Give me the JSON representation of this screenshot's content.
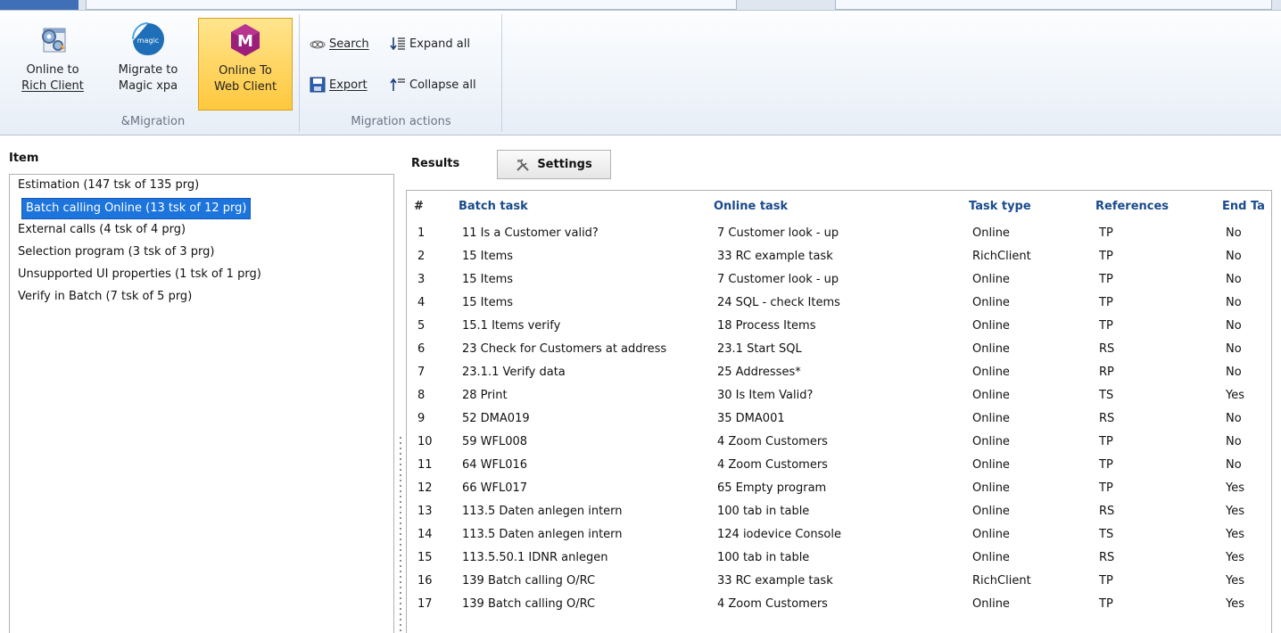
{
  "ribbon": {
    "groups": [
      {
        "label": "&Migration",
        "buttons": [
          {
            "label_line1": "Online to",
            "label_line2": "Rich Client",
            "icon": "gear-window-icon"
          },
          {
            "label_line1": "Migrate to",
            "label_line2": "Magic xpa",
            "icon": "magic-logo-icon",
            "icon_text": "magic"
          },
          {
            "label_line1": "Online To",
            "label_line2": "Web Client",
            "icon": "magic-m-icon",
            "icon_text": "M",
            "active": true
          }
        ]
      },
      {
        "label": "Migration actions",
        "buttons": [
          {
            "label": "Search",
            "icon": "search-glasses-icon"
          },
          {
            "label": "Export",
            "icon": "save-disk-icon"
          },
          {
            "label": "Expand all",
            "icon": "expand-all-icon"
          },
          {
            "label": "Collapse all",
            "icon": "collapse-all-icon"
          }
        ]
      }
    ]
  },
  "left_panel": {
    "title": "Item",
    "items": [
      {
        "label": "Estimation (147 tsk of 135 prg)"
      },
      {
        "label": "Batch calling Online (13 tsk of 12 prg)",
        "selected": true
      },
      {
        "label": "External calls (4 tsk of 4 prg)"
      },
      {
        "label": "Selection program (3 tsk of 3 prg)"
      },
      {
        "label": "Unsupported UI properties (1 tsk of 1 prg)"
      },
      {
        "label": "Verify in Batch (7 tsk of 5 prg)"
      }
    ]
  },
  "results": {
    "title": "Results",
    "settings_label": "Settings",
    "columns": [
      "#",
      "Batch task",
      "Online task",
      "Task type",
      "References",
      "End Ta"
    ],
    "rows": [
      [
        "1",
        "11 Is a Customer valid?",
        "7 Customer look - up",
        "Online",
        "TP",
        "No"
      ],
      [
        "2",
        "15 Items",
        "33 RC example task",
        "RichClient",
        "TP",
        "No"
      ],
      [
        "3",
        "15 Items",
        "7 Customer look - up",
        "Online",
        "TP",
        "No"
      ],
      [
        "4",
        "15 Items",
        "24 SQL - check Items",
        "Online",
        "TP",
        "No"
      ],
      [
        "5",
        "15.1 Items verify",
        "18 Process Items",
        "Online",
        "TP",
        "No"
      ],
      [
        "6",
        "23 Check for Customers at address",
        "23.1 Start SQL",
        "Online",
        "RS",
        "No"
      ],
      [
        "7",
        "23.1.1 Verify data",
        "25 Addresses*",
        "Online",
        "RP",
        "No"
      ],
      [
        "8",
        "28 Print",
        "30 Is Item Valid?",
        "Online",
        "TS",
        "Yes"
      ],
      [
        "9",
        "52 DMA019",
        "35 DMA001",
        "Online",
        "RS",
        "No"
      ],
      [
        "10",
        "59 WFL008",
        "4 Zoom Customers",
        "Online",
        "TP",
        "No"
      ],
      [
        "11",
        "64 WFL016",
        "4 Zoom Customers",
        "Online",
        "TP",
        "No"
      ],
      [
        "12",
        "66 WFL017",
        "65 Empty program",
        "Online",
        "TP",
        "Yes"
      ],
      [
        "13",
        "113.5 Daten anlegen intern",
        "100 tab in table",
        "Online",
        "RS",
        "Yes"
      ],
      [
        "14",
        "113.5 Daten anlegen intern",
        "124 iodevice Console",
        "Online",
        "TS",
        "Yes"
      ],
      [
        "15",
        "113.5.50.1 IDNR anlegen",
        "100 tab in table",
        "Online",
        "RS",
        "Yes"
      ],
      [
        "16",
        "139 Batch calling O/RC",
        "33 RC example task",
        "RichClient",
        "TP",
        "Yes"
      ],
      [
        "17",
        "139 Batch calling O/RC",
        "4 Zoom Customers",
        "Online",
        "TP",
        "Yes"
      ]
    ]
  },
  "colors": {
    "selection": "#1c74dc",
    "active_button": "#ffc83d",
    "header_text": "#1a4a8c"
  }
}
